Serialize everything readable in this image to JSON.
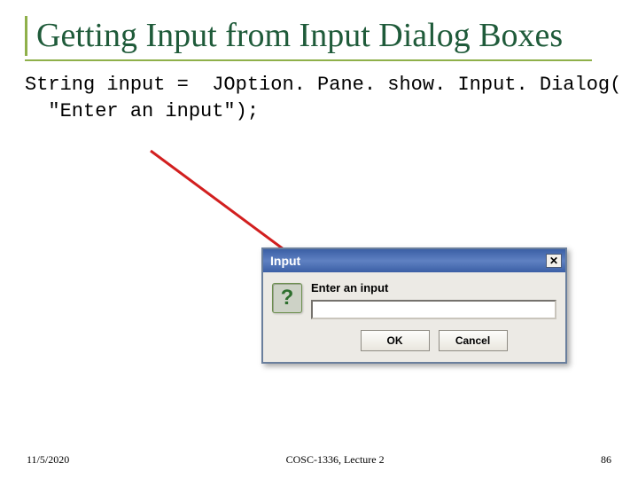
{
  "slide": {
    "title": "Getting Input from Input Dialog Boxes",
    "code_line1": "String input =  JOption. Pane. show. Input. Dialog(",
    "code_line2": "  \"Enter an input\");"
  },
  "dialog": {
    "title": "Input",
    "prompt": "Enter an input",
    "input_value": "",
    "ok_label": "OK",
    "cancel_label": "Cancel",
    "close_glyph": "✕",
    "question_glyph": "?"
  },
  "footer": {
    "date": "11/5/2020",
    "course": "COSC-1336, Lecture 2",
    "page": "86"
  },
  "colors": {
    "title_green": "#1f5b3a",
    "accent_green": "#8fb04a",
    "arrow_red": "#d21f1f",
    "titlebar_blue": "#3b5fa5"
  }
}
